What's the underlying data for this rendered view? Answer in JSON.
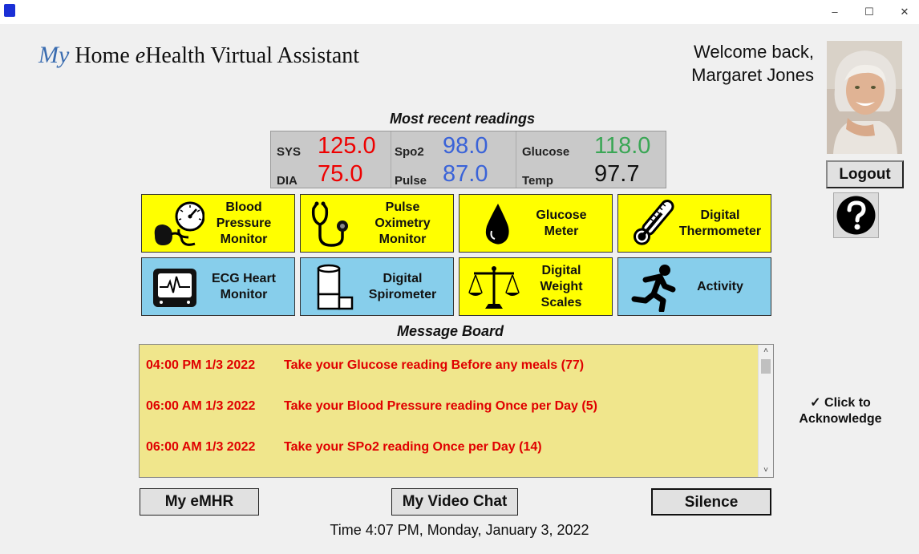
{
  "window": {
    "app_icon": "app-icon",
    "controls": {
      "minimize": "–",
      "maximize": "☐",
      "close": "✕"
    }
  },
  "header": {
    "title_prefix": "My",
    "title_part1": " Home ",
    "title_e": "e",
    "title_part2": "Health Virtual Assistant",
    "welcome_line1": "Welcome back,",
    "welcome_line2": "Margaret Jones"
  },
  "user": {
    "avatar": "user-photo",
    "logout_label": "Logout",
    "help_icon": "question-mark-icon"
  },
  "readings": {
    "title": "Most recent readings",
    "sys_label": "SYS",
    "sys_value": "125.0",
    "dia_label": "DIA",
    "dia_value": "75.0",
    "spo2_label": "Spo2",
    "spo2_value": "98.0",
    "pulse_label": "Pulse",
    "pulse_value": "87.0",
    "glucose_label": "Glucose",
    "glucose_value": "118.0",
    "temp_label": "Temp",
    "temp_value": "97.7",
    "colors": {
      "bp": "#ee0000",
      "oxy": "#3a63d8",
      "glucose": "#3aa655",
      "temp": "#111111"
    }
  },
  "devices": [
    {
      "label": "Blood\nPressure\nMonitor",
      "icon": "blood-pressure-monitor-icon",
      "color": "#ffff00"
    },
    {
      "label": "Pulse\nOximetry\nMonitor",
      "icon": "stethoscope-icon",
      "color": "#ffff00"
    },
    {
      "label": "Glucose\nMeter",
      "icon": "blood-drop-icon",
      "color": "#ffff00"
    },
    {
      "label": "Digital\nThermometer",
      "icon": "thermometer-icon",
      "color": "#ffff00"
    },
    {
      "label": "ECG Heart\nMonitor",
      "icon": "ecg-monitor-icon",
      "color": "#87ceeb"
    },
    {
      "label": "Digital\nSpirometer",
      "icon": "spirometer-icon",
      "color": "#87ceeb"
    },
    {
      "label": "Digital\nWeight\nScales",
      "icon": "scales-icon",
      "color": "#ffff00"
    },
    {
      "label": "Activity",
      "icon": "running-person-icon",
      "color": "#87ceeb"
    }
  ],
  "message_board": {
    "title": "Message Board",
    "messages": [
      {
        "time": "04:00 PM 1/3 2022",
        "text": "Take your Glucose reading Before any meals (77)"
      },
      {
        "time": "06:00 AM 1/3 2022",
        "text": "Take your Blood Pressure reading Once per Day (5)"
      },
      {
        "time": "06:00 AM 1/3 2022",
        "text": "Take your SPo2 reading Once per Day (14)"
      }
    ],
    "scroll_up": "˄",
    "scroll_down": "˅"
  },
  "acknowledge": {
    "line1": "✓ Click to",
    "line2": "Acknowledge"
  },
  "footer": {
    "emhr_label": "My eMHR",
    "video_chat_label": "My Video Chat",
    "silence_label": "Silence",
    "time_text": "Time 4:07 PM, Monday, January 3, 2022"
  }
}
